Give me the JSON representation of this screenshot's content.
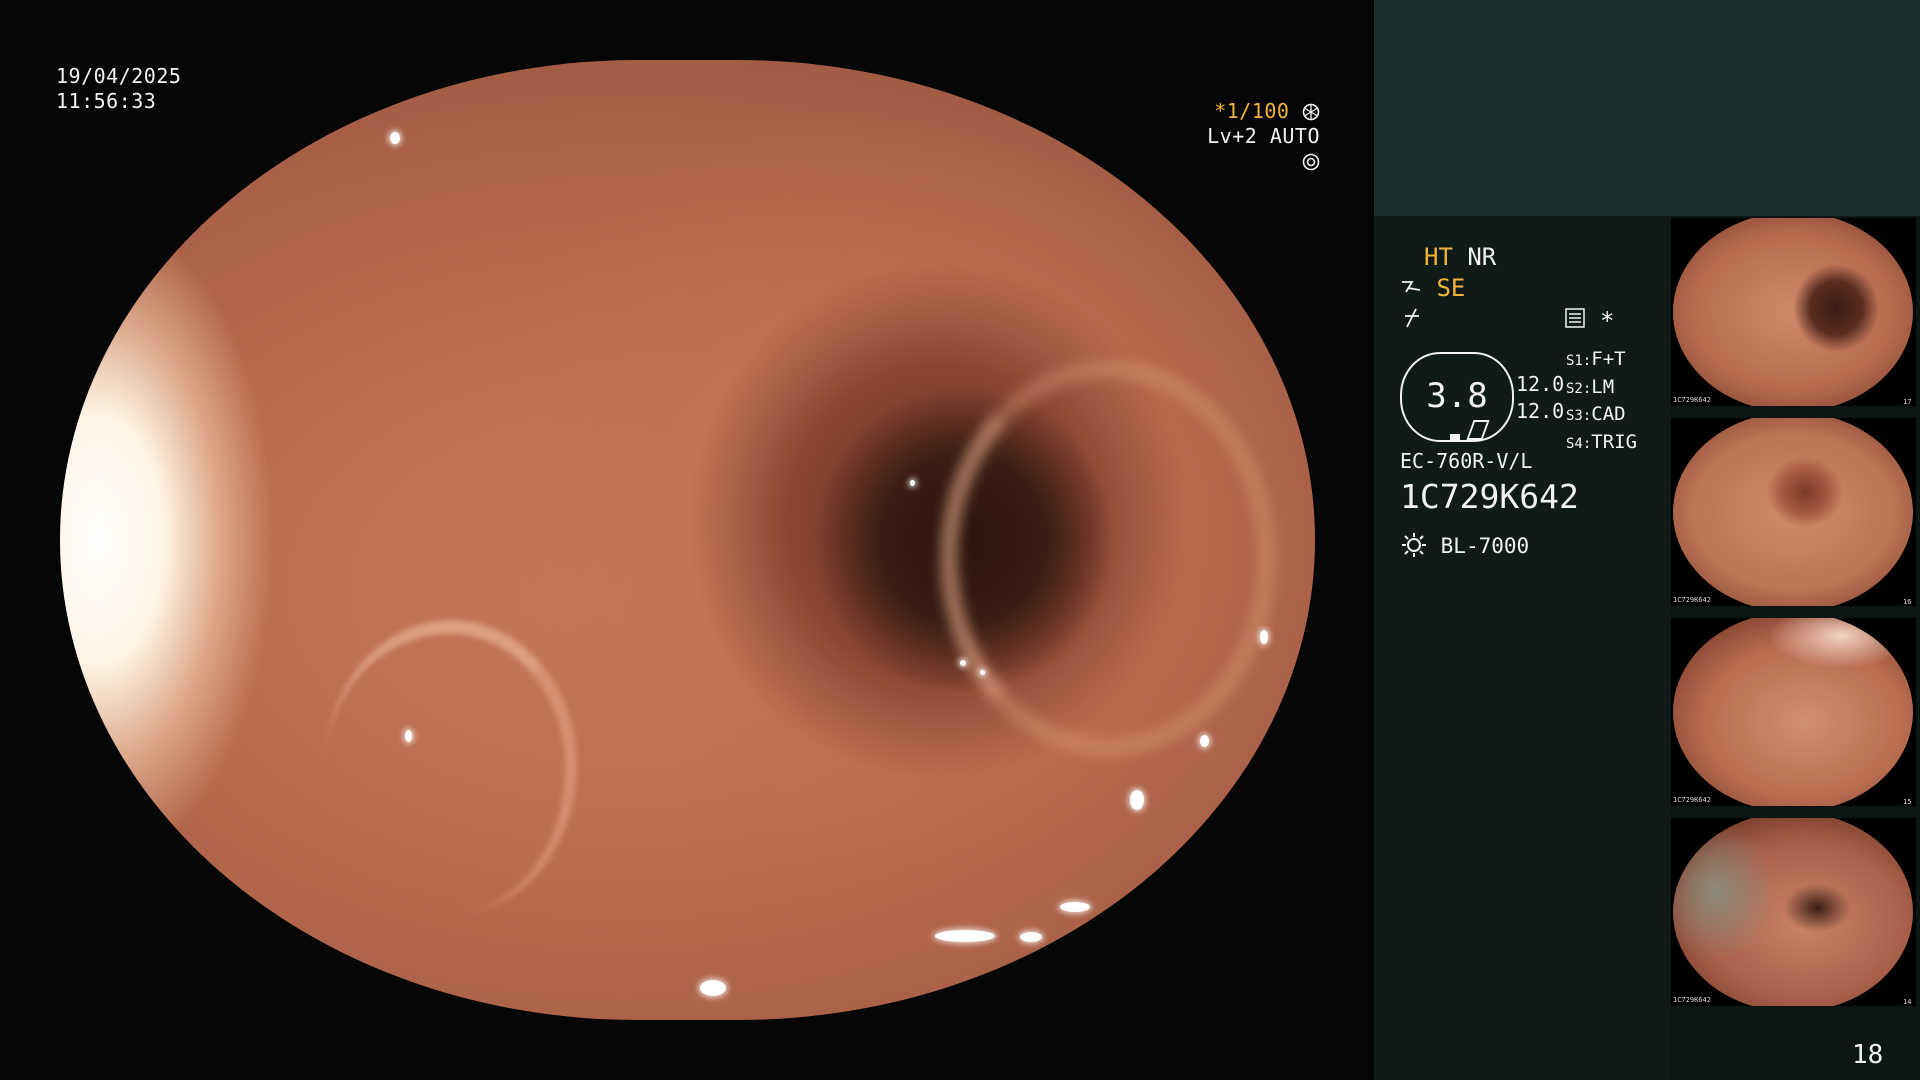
{
  "overlay": {
    "date": "19/04/2025",
    "time": "11:56:33",
    "shutter": "*1/100",
    "shutter_icon": "aperture-icon",
    "level": "Lv+2 AUTO",
    "level_icon": "iris-icon"
  },
  "panel": {
    "mode_ht": "HT",
    "mode_nr": "NR",
    "mode_se": "SE",
    "asterisk": "*",
    "gauge_value": "3.8",
    "val1": "12.0",
    "val2": "12.0",
    "switches": [
      {
        "key": "S1:",
        "value": "F+T"
      },
      {
        "key": "S2:",
        "value": "LM"
      },
      {
        "key": "S3:",
        "value": "CAD"
      },
      {
        "key": "S4:",
        "value": "TRIG"
      }
    ],
    "scope_model": "EC-760R-V/L",
    "serial": "1C729K642",
    "light_source": "BL-7000",
    "frame_number": "18"
  },
  "thumbnails": [
    {
      "serial": "1C729K642",
      "index": "17"
    },
    {
      "serial": "1C729K642",
      "index": "16"
    },
    {
      "serial": "1C729K642",
      "index": "15"
    },
    {
      "serial": "1C729K642",
      "index": "14"
    }
  ],
  "colors": {
    "accent": "#f3b43c",
    "panel_top": "#1b2f2c",
    "panel": "#0c1615"
  }
}
